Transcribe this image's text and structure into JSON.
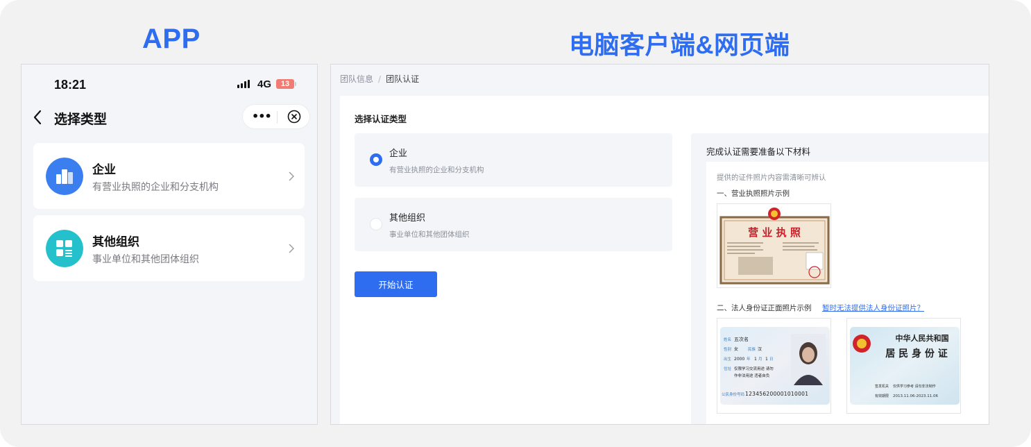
{
  "headings": {
    "app": "APP",
    "pc": "电脑客户端&网页端"
  },
  "app": {
    "status_bar": {
      "time": "18:21",
      "network": "4G",
      "battery": "13"
    },
    "nav": {
      "title": "选择类型",
      "more": "•••"
    },
    "options": [
      {
        "title": "企业",
        "desc": "有营业执照的企业和分支机构",
        "icon": "building-icon",
        "icon_color": "#3a7ef0"
      },
      {
        "title": "其他组织",
        "desc": "事业单位和其他团体组织",
        "icon": "grid-list-icon",
        "icon_color": "#24c0cc"
      }
    ]
  },
  "pc": {
    "breadcrumb": {
      "parent": "团队信息",
      "separator": "/",
      "current": "团队认证"
    },
    "section_title": "选择认证类型",
    "options": [
      {
        "title": "企业",
        "desc": "有营业执照的企业和分支机构",
        "selected": true
      },
      {
        "title": "其他组织",
        "desc": "事业单位和其他团体组织",
        "selected": false
      }
    ],
    "start_button": "开始认证",
    "materials": {
      "title": "完成认证需要准备以下材料",
      "hint": "提供的证件照片内容需清晰可辨认",
      "license_heading": "一、营业执照照片示例",
      "license_image": {
        "title": "营 业 执 照"
      },
      "id_heading": "二、法人身份证正面照片示例",
      "id_link": "暂时无法提供法人身份证照片？",
      "id_front": {
        "name_label": "姓名",
        "name": "五次名",
        "gender_label": "性别",
        "gender": "女",
        "ethnicity_label": "民族",
        "ethnicity": "汉",
        "birth_label": "出生",
        "birth_year": "2000",
        "birth_year_unit": "年",
        "birth_month": "1",
        "birth_month_unit": "月",
        "birth_day": "1",
        "birth_day_unit": "日",
        "address_label": "住址",
        "address_line1": "仅限学习交流用途 请勿",
        "address_line2": "作非法用途 违者自负",
        "id_label": "公民身份号码",
        "id_number": "123456200001010001"
      },
      "id_back": {
        "line1": "中华人民共和国",
        "line2": "居 民 身 份 证",
        "authority_label": "签发机关",
        "authority": "仅供学习参考 请勿非法制作",
        "validity_label": "有效期限",
        "validity": "2013.11.06-2023.11.06"
      }
    }
  }
}
